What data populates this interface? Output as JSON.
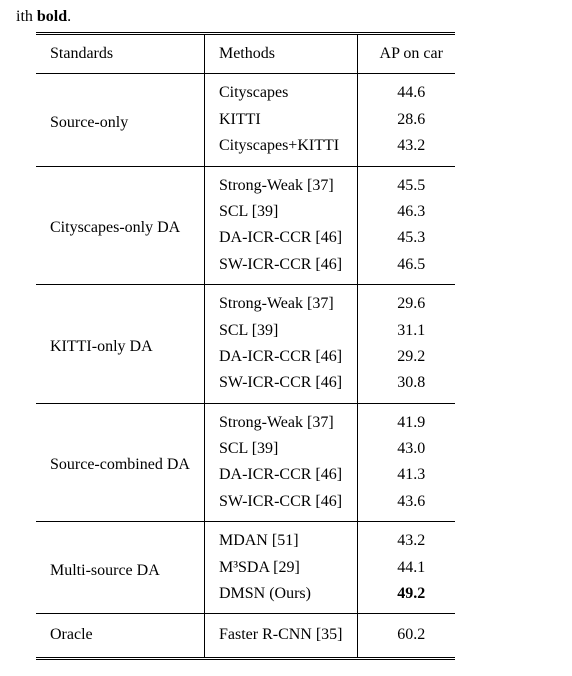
{
  "caption_fragment": {
    "prefix": "ith ",
    "bold_word": "bold",
    "suffix": "."
  },
  "columns": {
    "standards": "Standards",
    "methods": "Methods",
    "ap": "AP on car"
  },
  "groups": [
    {
      "name": "Source-only",
      "rows": [
        {
          "method": "Cityscapes",
          "ap": "44.6"
        },
        {
          "method": "KITTI",
          "ap": "28.6"
        },
        {
          "method": "Cityscapes+KITTI",
          "ap": "43.2"
        }
      ]
    },
    {
      "name": "Cityscapes-only DA",
      "rows": [
        {
          "method": "Strong-Weak [37]",
          "ap": "45.5"
        },
        {
          "method": "SCL [39]",
          "ap": "46.3"
        },
        {
          "method": "DA-ICR-CCR [46]",
          "ap": "45.3"
        },
        {
          "method": "SW-ICR-CCR [46]",
          "ap": "46.5"
        }
      ]
    },
    {
      "name": "KITTI-only DA",
      "rows": [
        {
          "method": "Strong-Weak [37]",
          "ap": "29.6"
        },
        {
          "method": "SCL [39]",
          "ap": "31.1"
        },
        {
          "method": "DA-ICR-CCR [46]",
          "ap": "29.2"
        },
        {
          "method": "SW-ICR-CCR [46]",
          "ap": "30.8"
        }
      ]
    },
    {
      "name": "Source-combined DA",
      "rows": [
        {
          "method": "Strong-Weak [37]",
          "ap": "41.9"
        },
        {
          "method": "SCL [39]",
          "ap": "43.0"
        },
        {
          "method": "DA-ICR-CCR [46]",
          "ap": "41.3"
        },
        {
          "method": "SW-ICR-CCR [46]",
          "ap": "43.6"
        }
      ]
    },
    {
      "name": "Multi-source DA",
      "rows": [
        {
          "method": "MDAN [51]",
          "ap": "43.2"
        },
        {
          "method": "M³SDA [29]",
          "ap": "44.1"
        },
        {
          "method": "DMSN (Ours)",
          "ap": "49.2",
          "bold_ap": true
        }
      ]
    },
    {
      "name": "Oracle",
      "rows": [
        {
          "method": "Faster R-CNN [35]",
          "ap": "60.2"
        }
      ]
    }
  ],
  "chart_data": {
    "type": "table",
    "title": "AP on car",
    "rows": [
      {
        "standards": "Source-only",
        "method": "Cityscapes",
        "ap": 44.6
      },
      {
        "standards": "Source-only",
        "method": "KITTI",
        "ap": 28.6
      },
      {
        "standards": "Source-only",
        "method": "Cityscapes+KITTI",
        "ap": 43.2
      },
      {
        "standards": "Cityscapes-only DA",
        "method": "Strong-Weak [37]",
        "ap": 45.5
      },
      {
        "standards": "Cityscapes-only DA",
        "method": "SCL [39]",
        "ap": 46.3
      },
      {
        "standards": "Cityscapes-only DA",
        "method": "DA-ICR-CCR [46]",
        "ap": 45.3
      },
      {
        "standards": "Cityscapes-only DA",
        "method": "SW-ICR-CCR [46]",
        "ap": 46.5
      },
      {
        "standards": "KITTI-only DA",
        "method": "Strong-Weak [37]",
        "ap": 29.6
      },
      {
        "standards": "KITTI-only DA",
        "method": "SCL [39]",
        "ap": 31.1
      },
      {
        "standards": "KITTI-only DA",
        "method": "DA-ICR-CCR [46]",
        "ap": 29.2
      },
      {
        "standards": "KITTI-only DA",
        "method": "SW-ICR-CCR [46]",
        "ap": 30.8
      },
      {
        "standards": "Source-combined DA",
        "method": "Strong-Weak [37]",
        "ap": 41.9
      },
      {
        "standards": "Source-combined DA",
        "method": "SCL [39]",
        "ap": 43.0
      },
      {
        "standards": "Source-combined DA",
        "method": "DA-ICR-CCR [46]",
        "ap": 41.3
      },
      {
        "standards": "Source-combined DA",
        "method": "SW-ICR-CCR [46]",
        "ap": 43.6
      },
      {
        "standards": "Multi-source DA",
        "method": "MDAN [51]",
        "ap": 43.2
      },
      {
        "standards": "Multi-source DA",
        "method": "M3SDA [29]",
        "ap": 44.1
      },
      {
        "standards": "Multi-source DA",
        "method": "DMSN (Ours)",
        "ap": 49.2
      },
      {
        "standards": "Oracle",
        "method": "Faster R-CNN [35]",
        "ap": 60.2
      }
    ]
  }
}
